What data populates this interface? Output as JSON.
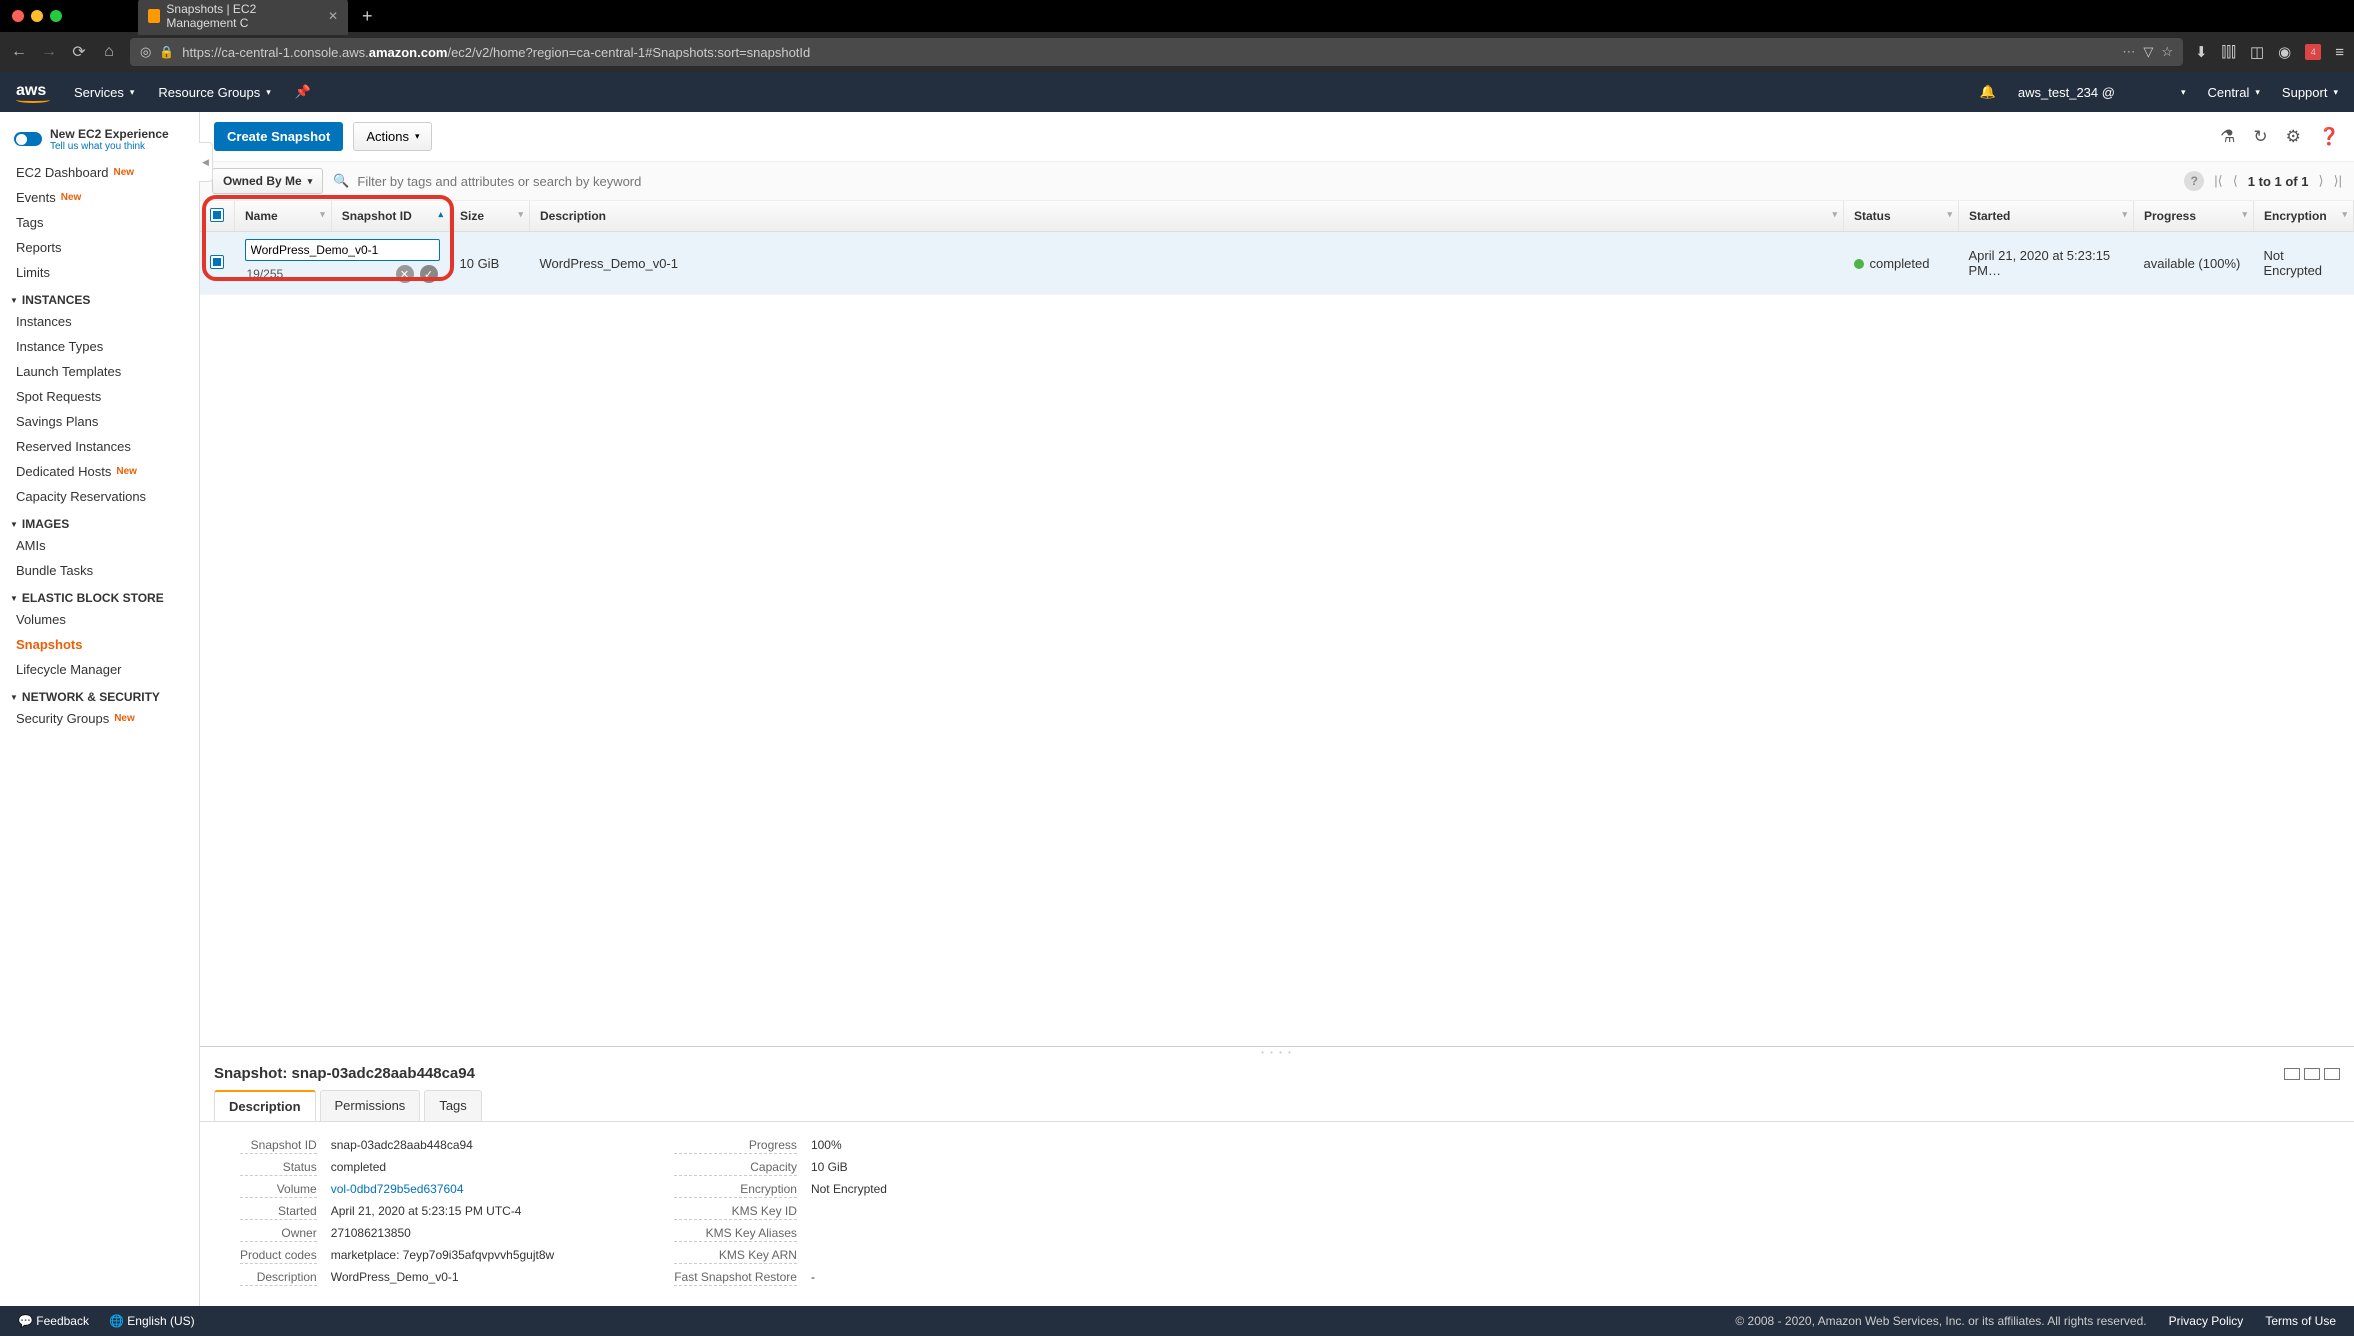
{
  "browser": {
    "tab_title": "Snapshots | EC2 Management C",
    "url_prefix": "https://ca-central-1.console.aws.",
    "url_bold": "amazon.com",
    "url_suffix": "/ec2/v2/home?region=ca-central-1#Snapshots:sort=snapshotId"
  },
  "aws_nav": {
    "services": "Services",
    "resource_groups": "Resource Groups",
    "user": "aws_test_234 @",
    "region": "Central",
    "support": "Support"
  },
  "sidebar": {
    "new_experience": "New EC2 Experience",
    "new_experience_sub": "Tell us what you think",
    "dashboard": "EC2 Dashboard",
    "events": "Events",
    "tags": "Tags",
    "reports": "Reports",
    "limits": "Limits",
    "group_instances": "INSTANCES",
    "instances": "Instances",
    "instance_types": "Instance Types",
    "launch_templates": "Launch Templates",
    "spot": "Spot Requests",
    "savings": "Savings Plans",
    "reserved": "Reserved Instances",
    "dedicated": "Dedicated Hosts",
    "capacity": "Capacity Reservations",
    "group_images": "IMAGES",
    "amis": "AMIs",
    "bundle": "Bundle Tasks",
    "group_ebs": "ELASTIC BLOCK STORE",
    "volumes": "Volumes",
    "snapshots": "Snapshots",
    "lifecycle": "Lifecycle Manager",
    "group_net": "NETWORK & SECURITY",
    "sg": "Security Groups",
    "new_tag": "New"
  },
  "actions": {
    "create": "Create Snapshot",
    "actions": "Actions"
  },
  "filter": {
    "owned": "Owned By Me",
    "placeholder": "Filter by tags and attributes or search by keyword",
    "pager": "1 to 1 of 1"
  },
  "table": {
    "headers": {
      "name": "Name",
      "snapid": "Snapshot ID",
      "size": "Size",
      "desc": "Description",
      "status": "Status",
      "started": "Started",
      "progress": "Progress",
      "enc": "Encryption"
    },
    "row": {
      "name_value": "WordPress_Demo_v0-1",
      "name_counter": "19/255",
      "size": "10 GiB",
      "desc": "WordPress_Demo_v0-1",
      "status": "completed",
      "started": "April 21, 2020 at 5:23:15 PM…",
      "progress": "available (100%)",
      "enc": "Not Encrypted"
    }
  },
  "detail": {
    "title": "Snapshot: snap-03adc28aab448ca94",
    "tabs": {
      "desc": "Description",
      "perm": "Permissions",
      "tags": "Tags"
    },
    "left": {
      "snapshot_id_l": "Snapshot ID",
      "snapshot_id_v": "snap-03adc28aab448ca94",
      "status_l": "Status",
      "status_v": "completed",
      "volume_l": "Volume",
      "volume_v": "vol-0dbd729b5ed637604",
      "started_l": "Started",
      "started_v": "April 21, 2020 at 5:23:15 PM UTC-4",
      "owner_l": "Owner",
      "owner_v": "271086213850",
      "prodcodes_l": "Product codes",
      "prodcodes_v": "marketplace: 7eyp7o9i35afqvpvvh5gujt8w",
      "desc_l": "Description",
      "desc_v": "WordPress_Demo_v0-1"
    },
    "right": {
      "progress_l": "Progress",
      "progress_v": "100%",
      "capacity_l": "Capacity",
      "capacity_v": "10 GiB",
      "enc_l": "Encryption",
      "enc_v": "Not Encrypted",
      "kmsid_l": "KMS Key ID",
      "kmsid_v": "",
      "kmsal_l": "KMS Key Aliases",
      "kmsal_v": "",
      "kmsarn_l": "KMS Key ARN",
      "kmsarn_v": "",
      "fast_l": "Fast Snapshot Restore",
      "fast_v": "-"
    }
  },
  "footer": {
    "feedback": "Feedback",
    "lang": "English (US)",
    "copyright": "© 2008 - 2020, Amazon Web Services, Inc. or its affiliates. All rights reserved.",
    "privacy": "Privacy Policy",
    "terms": "Terms of Use"
  }
}
